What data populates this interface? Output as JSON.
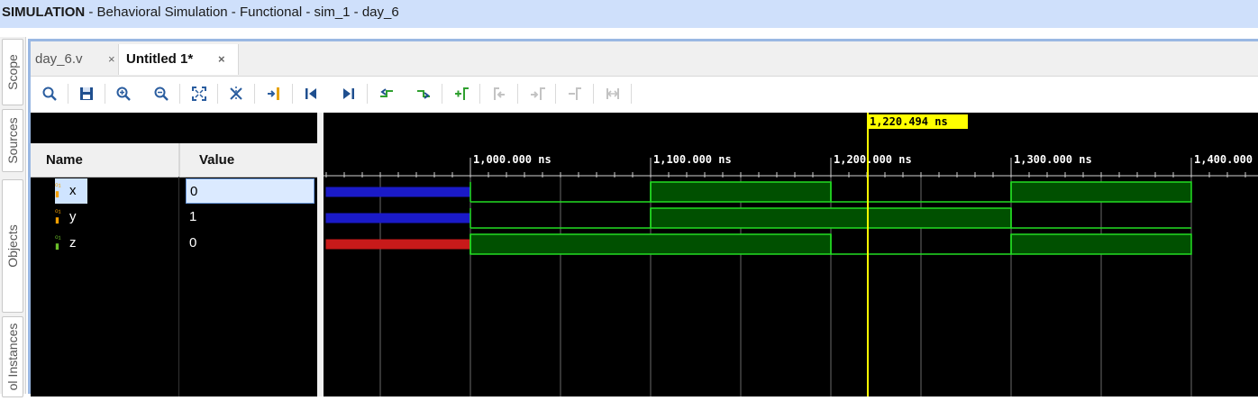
{
  "titlebar": {
    "mode": "SIMULATION",
    "rest": " - Behavioral Simulation - Functional - sim_1 - day_6"
  },
  "sidebar": {
    "tabs": [
      "Scope",
      "Sources",
      "Objects",
      "ol Instances"
    ]
  },
  "tabs": [
    {
      "label": "day_6.v",
      "active": false
    },
    {
      "label": "Untitled 1*",
      "active": true
    }
  ],
  "close_glyph": "×",
  "toolbar": {
    "icons": [
      "search",
      "save",
      "zoom-in",
      "zoom-out",
      "zoom-fit",
      "cut-marker",
      "go-to-cursor",
      "go-to-time-0",
      "go-to-last-time",
      "previous-transition",
      "next-transition",
      "add-marker",
      "previous-marker",
      "next-marker",
      "swap-cursors",
      "marker-ruler"
    ]
  },
  "columns": {
    "name": "Name",
    "value": "Value"
  },
  "signals": [
    {
      "name": "x",
      "value": "0",
      "selected": true
    },
    {
      "name": "y",
      "value": "1",
      "selected": false
    },
    {
      "name": "z",
      "value": "0",
      "selected": false
    }
  ],
  "cursor": {
    "label": "1,220.494 ns",
    "time_ns": 1220.494,
    "color": "#ffff00"
  },
  "ruler": {
    "ticks": [
      "1,000.000 ns",
      "1,100.000 ns",
      "1,200.000 ns",
      "1,300.000 ns",
      "1,400.000"
    ],
    "tick_times_ns": [
      1000,
      1100,
      1200,
      1300,
      1400
    ]
  },
  "waveforms": {
    "window_ns": [
      920,
      1437
    ],
    "x": {
      "undefined_until_ns": 1000,
      "edges": [
        [
          1000,
          0
        ],
        [
          1100,
          1
        ],
        [
          1200,
          0
        ],
        [
          1300,
          1
        ],
        [
          1400,
          1
        ]
      ]
    },
    "y": {
      "undefined_until_ns": 1000,
      "edges": [
        [
          1000,
          0
        ],
        [
          1100,
          1
        ],
        [
          1300,
          0
        ],
        [
          1400,
          0
        ]
      ]
    },
    "z": {
      "undefined_until_ns": 1000,
      "edges": [
        [
          1000,
          1
        ],
        [
          1200,
          0
        ],
        [
          1300,
          1
        ],
        [
          1400,
          1
        ]
      ]
    }
  },
  "colors": {
    "wave_green": "#22dd22",
    "wave_fill": "#005000",
    "undefined_blue": "#1a1ac8",
    "undefined_red": "#c81a1a",
    "titlebar": "#cfe0fb"
  }
}
